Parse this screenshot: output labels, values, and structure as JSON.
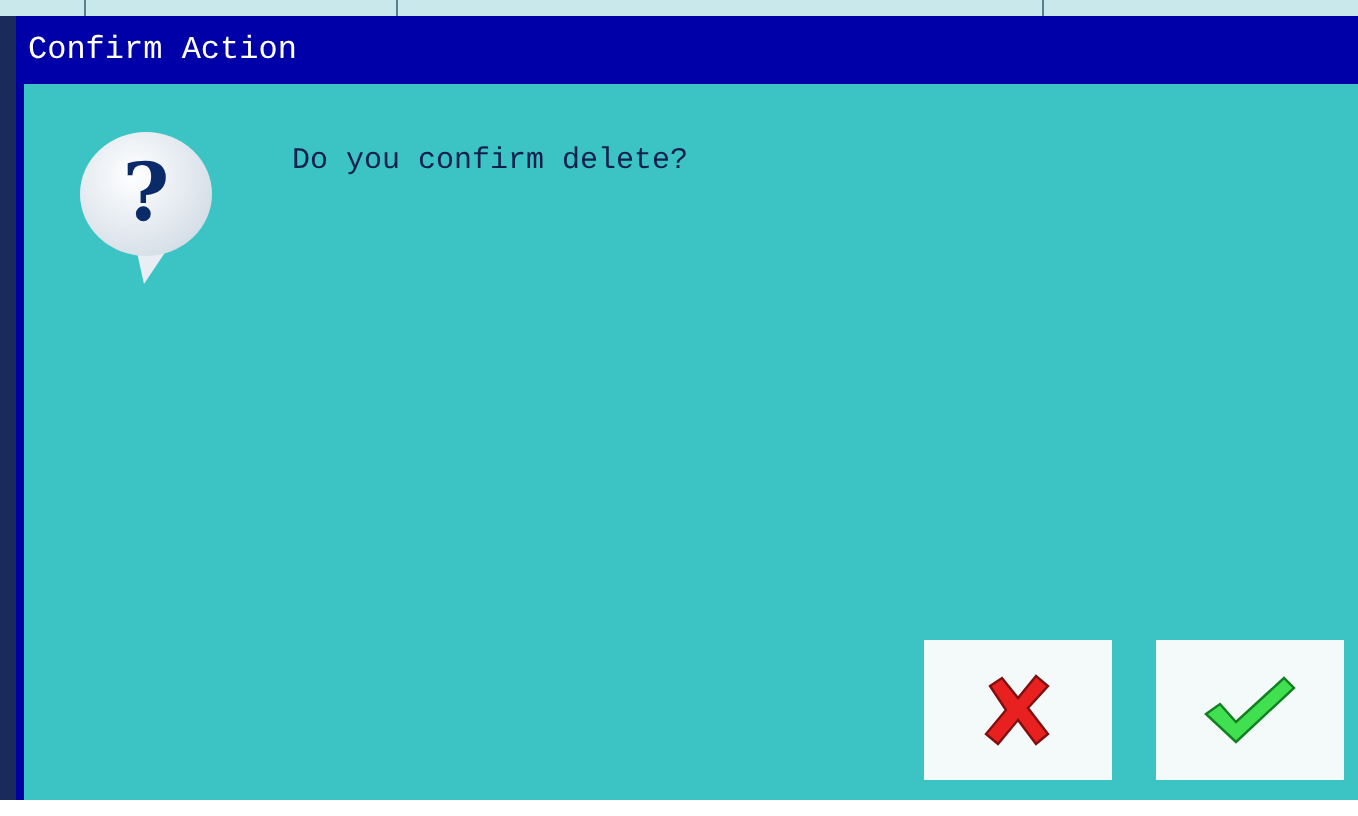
{
  "window": {
    "title": "Confirm Action"
  },
  "dialog": {
    "icon_glyph": "?",
    "message": "Do you confirm delete?"
  },
  "buttons": [
    {
      "kind": "cancel"
    },
    {
      "kind": "confirm"
    }
  ]
}
